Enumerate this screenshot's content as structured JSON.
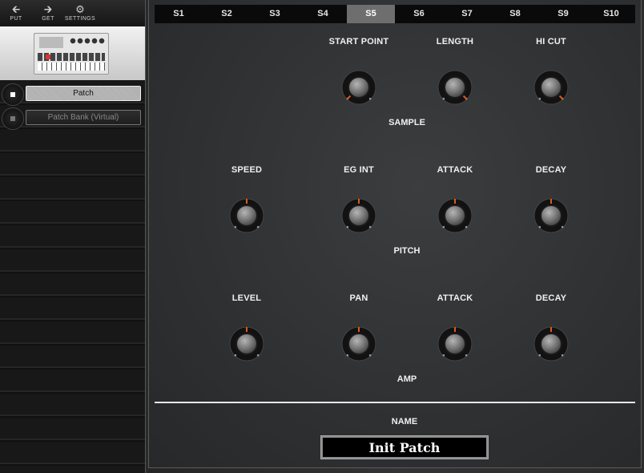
{
  "toolbar": {
    "put_label": "PUT",
    "put_icon": "arrow-left-icon",
    "get_label": "GET",
    "get_icon": "arrow-right-icon",
    "settings_label": "SETTINGS",
    "settings_icon": "gear-icon"
  },
  "sidebar": {
    "items": [
      {
        "label": "Patch",
        "active": true
      },
      {
        "label": "Patch Bank (Virtual)",
        "active": false
      }
    ]
  },
  "tabs": [
    "S1",
    "S2",
    "S3",
    "S4",
    "S5",
    "S6",
    "S7",
    "S8",
    "S9",
    "S10"
  ],
  "active_tab": "S5",
  "sections": {
    "sample": {
      "title": "SAMPLE",
      "params": [
        {
          "label": "START POINT",
          "value": 0.0
        },
        {
          "label": "LENGTH",
          "value": 1.0
        },
        {
          "label": "HI CUT",
          "value": 1.0
        }
      ]
    },
    "pitch": {
      "title": "PITCH",
      "params": [
        {
          "label": "SPEED",
          "value": 0.5
        },
        {
          "label": "EG INT",
          "value": 0.5
        },
        {
          "label": "ATTACK",
          "value": 0.5
        },
        {
          "label": "DECAY",
          "value": 0.5
        }
      ]
    },
    "amp": {
      "title": "AMP",
      "params": [
        {
          "label": "LEVEL",
          "value": 0.5
        },
        {
          "label": "PAN",
          "value": 0.5
        },
        {
          "label": "ATTACK",
          "value": 0.5
        },
        {
          "label": "DECAY",
          "value": 0.5
        }
      ]
    }
  },
  "name": {
    "label": "NAME",
    "value": "Init Patch"
  },
  "colors": {
    "indicator": "#e05a1a",
    "tab_active": "#6e6e6e"
  }
}
